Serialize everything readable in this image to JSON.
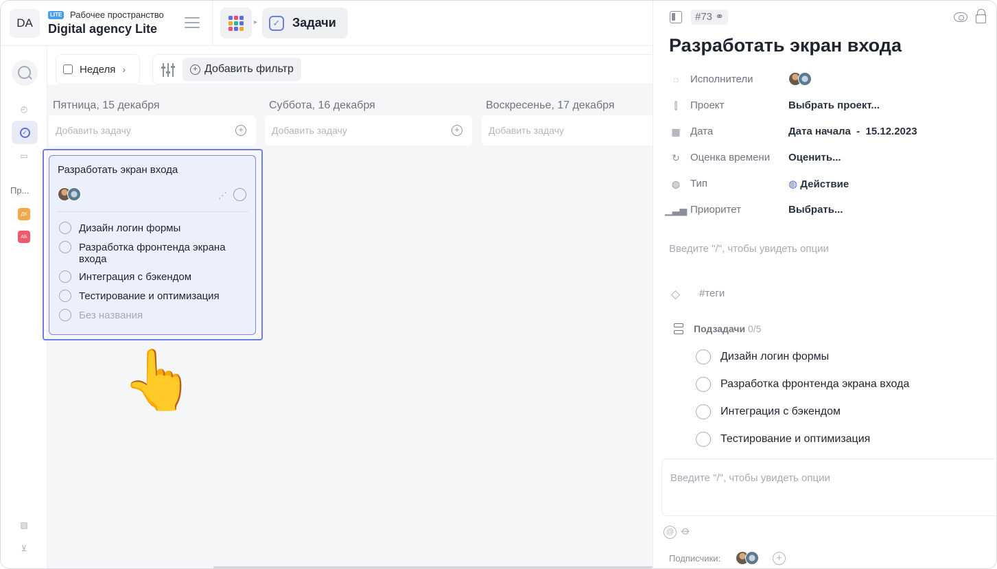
{
  "workspace": {
    "avatar": "DA",
    "badge": "LITE",
    "label": "Рабочее пространство",
    "name": "Digital agency Lite"
  },
  "header": {
    "tab_label": "Задачи",
    "app_grid_colors": [
      "#5b6ee6",
      "#f0506e",
      "#5b6ee6",
      "#f5a623",
      "#29b6a0",
      "#5b6ee6",
      "#f0506e",
      "#5b6ee6",
      "#f5a623"
    ]
  },
  "sidebar": {
    "projects_label": "Пр...",
    "projects": [
      {
        "badge": "ДК",
        "color": "#f3a64a"
      },
      {
        "badge": "АБ",
        "color": "#ee5a6a"
      }
    ]
  },
  "toolbar": {
    "week_label": "Неделя",
    "add_filter_label": "Добавить фильтр"
  },
  "board": {
    "columns": [
      {
        "title": "Пятница, 15 декабря",
        "add_placeholder": "Добавить задачу"
      },
      {
        "title": "Суббота, 16 декабря",
        "add_placeholder": "Добавить задачу"
      },
      {
        "title": "Воскресенье, 17 декабря",
        "add_placeholder": "Добавить задачу"
      }
    ],
    "card": {
      "title": "Разработать экран входа",
      "subtasks": [
        "Дизайн логин формы",
        "Разработка фронтенда экрана входа",
        "Интеграция с бэкендом",
        "Тестирование и оптимизация",
        "Без названия"
      ]
    },
    "pointer_emoji": "👆"
  },
  "panel": {
    "task_id": "#73",
    "title": "Разработать экран входа",
    "properties": [
      {
        "label": "Исполнители",
        "value": "",
        "icon": "assignees-icon"
      },
      {
        "label": "Проект",
        "value": "Выбрать проект...",
        "icon": "project-icon"
      },
      {
        "label": "Дата",
        "value": "Дата начала  -  15.12.2023",
        "icon": "calendar-icon"
      },
      {
        "label": "Оценка времени",
        "value": "Оценить...",
        "icon": "timer-icon"
      },
      {
        "label": "Тип",
        "value": "Действие",
        "icon": "type-icon"
      },
      {
        "label": "Приоритет",
        "value": "Выбрать...",
        "icon": "priority-icon"
      }
    ],
    "description_placeholder": "Введите \"/\", чтобы увидеть опции",
    "tags_placeholder": "#теги",
    "subtasks_title": "Подзадачи",
    "subtasks_count": "0/5",
    "subtasks": [
      "Дизайн логин формы",
      "Разработка фронтенда экрана входа",
      "Интеграция с бэкендом",
      "Тестирование и оптимизация"
    ],
    "comment_placeholder": "Введите \"/\", чтобы увидеть опции",
    "subscribers_label": "Подписчики:",
    "accent_color": "#5a6fd6"
  }
}
